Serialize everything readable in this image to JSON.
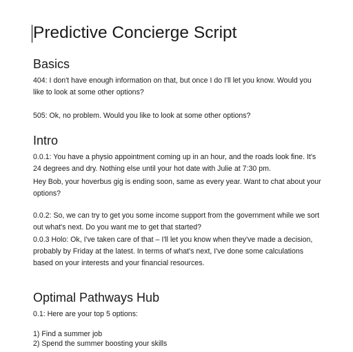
{
  "document": {
    "title": "Predictive Concierge Script",
    "sections": {
      "basics": {
        "heading": "Basics",
        "p1": "404: I don't have enough information on that, but once I do I'll let you know. Would you like to look at some other options?",
        "p2": "505: Ok, no problem. Would you like to look at some other options?"
      },
      "intro": {
        "heading": "Intro",
        "p1": "0.0.1: You have a physio appointment coming up in an hour, and the roads look fine. It's 24 degrees and dry. Nothing else until your hot date with Julie at 7:30 pm.",
        "p2": "Hey Bob, your hoverbus gig is ending soon, same as every year. Want to chat about your options?",
        "p3": "0.0.2: So, we can try to get you some income support from the government while we sort out what's next. Do you want me to get that started?",
        "p4": "0.0.3 Holo: Ok, I've taken care of that – I'll let you know when they've made a decision, probably by Friday at the latest. In terms of what's next, I've done some calculations based on your interests and your financial resources."
      },
      "hub": {
        "heading": "Optimal Pathways Hub",
        "p1": "0.1: Here are your top 5 options:",
        "list": [
          "1) Find a summer job",
          "2) Spend the summer boosting your skills"
        ]
      }
    }
  }
}
